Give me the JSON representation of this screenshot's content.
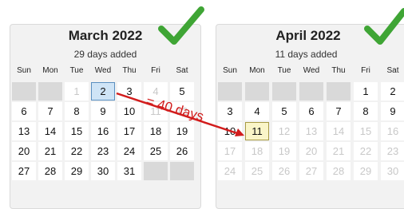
{
  "march": {
    "title": "March 2022",
    "subtitle": "29 days added",
    "weekdays": [
      "Sun",
      "Mon",
      "Tue",
      "Wed",
      "Thu",
      "Fri",
      "Sat"
    ],
    "rows": [
      [
        {
          "d": "",
          "t": "empty"
        },
        {
          "d": "",
          "t": "empty"
        },
        {
          "d": "1",
          "t": "dim"
        },
        {
          "d": "2",
          "t": "selected"
        },
        {
          "d": "3",
          "t": "normal"
        },
        {
          "d": "4",
          "t": "dim"
        },
        {
          "d": "5",
          "t": "normal"
        }
      ],
      [
        {
          "d": "6",
          "t": "normal"
        },
        {
          "d": "7",
          "t": "normal"
        },
        {
          "d": "8",
          "t": "normal"
        },
        {
          "d": "9",
          "t": "normal"
        },
        {
          "d": "10",
          "t": "normal"
        },
        {
          "d": "11",
          "t": "dim"
        },
        {
          "d": "12",
          "t": "dim"
        }
      ],
      [
        {
          "d": "13",
          "t": "normal"
        },
        {
          "d": "14",
          "t": "normal"
        },
        {
          "d": "15",
          "t": "normal"
        },
        {
          "d": "16",
          "t": "normal"
        },
        {
          "d": "17",
          "t": "normal"
        },
        {
          "d": "18",
          "t": "normal"
        },
        {
          "d": "19",
          "t": "normal"
        }
      ],
      [
        {
          "d": "20",
          "t": "normal"
        },
        {
          "d": "21",
          "t": "normal"
        },
        {
          "d": "22",
          "t": "normal"
        },
        {
          "d": "23",
          "t": "normal"
        },
        {
          "d": "24",
          "t": "normal"
        },
        {
          "d": "25",
          "t": "normal"
        },
        {
          "d": "26",
          "t": "normal"
        }
      ],
      [
        {
          "d": "27",
          "t": "normal"
        },
        {
          "d": "28",
          "t": "normal"
        },
        {
          "d": "29",
          "t": "normal"
        },
        {
          "d": "30",
          "t": "normal"
        },
        {
          "d": "31",
          "t": "normal"
        },
        {
          "d": "",
          "t": "empty"
        },
        {
          "d": "",
          "t": "empty"
        }
      ]
    ]
  },
  "april": {
    "title": "April 2022",
    "subtitle": "11 days added",
    "weekdays": [
      "Sun",
      "Mon",
      "Tue",
      "Wed",
      "Thu",
      "Fri",
      "Sat"
    ],
    "rows": [
      [
        {
          "d": "",
          "t": "empty"
        },
        {
          "d": "",
          "t": "empty"
        },
        {
          "d": "",
          "t": "empty"
        },
        {
          "d": "",
          "t": "empty"
        },
        {
          "d": "",
          "t": "empty"
        },
        {
          "d": "1",
          "t": "normal"
        },
        {
          "d": "2",
          "t": "normal"
        }
      ],
      [
        {
          "d": "3",
          "t": "normal"
        },
        {
          "d": "4",
          "t": "normal"
        },
        {
          "d": "5",
          "t": "normal"
        },
        {
          "d": "6",
          "t": "normal"
        },
        {
          "d": "7",
          "t": "normal"
        },
        {
          "d": "8",
          "t": "normal"
        },
        {
          "d": "9",
          "t": "normal"
        }
      ],
      [
        {
          "d": "10",
          "t": "normal"
        },
        {
          "d": "11",
          "t": "highlight"
        },
        {
          "d": "12",
          "t": "dim"
        },
        {
          "d": "13",
          "t": "dim"
        },
        {
          "d": "14",
          "t": "dim"
        },
        {
          "d": "15",
          "t": "dim"
        },
        {
          "d": "16",
          "t": "dim"
        }
      ],
      [
        {
          "d": "17",
          "t": "dim"
        },
        {
          "d": "18",
          "t": "dim"
        },
        {
          "d": "19",
          "t": "dim"
        },
        {
          "d": "20",
          "t": "dim"
        },
        {
          "d": "21",
          "t": "dim"
        },
        {
          "d": "22",
          "t": "dim"
        },
        {
          "d": "23",
          "t": "dim"
        }
      ],
      [
        {
          "d": "24",
          "t": "dim"
        },
        {
          "d": "25",
          "t": "dim"
        },
        {
          "d": "26",
          "t": "dim"
        },
        {
          "d": "27",
          "t": "dim"
        },
        {
          "d": "28",
          "t": "dim"
        },
        {
          "d": "29",
          "t": "dim"
        },
        {
          "d": "30",
          "t": "dim"
        }
      ]
    ]
  },
  "annotation": {
    "text": "= 40 days",
    "color": "#d21c1c"
  },
  "icons": {
    "check": "check-icon"
  },
  "colors": {
    "check": "#3fa535",
    "selected_fill": "#cfe4f6",
    "highlight_fill": "#faf5c8"
  }
}
